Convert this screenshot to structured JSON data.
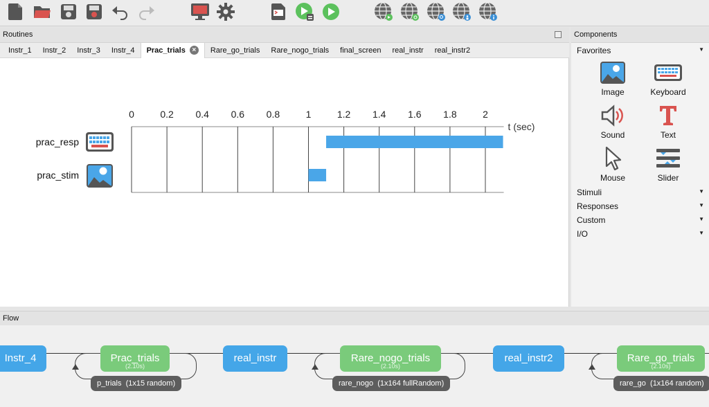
{
  "toolbar": {
    "buttons": [
      {
        "icon": "new-file-icon"
      },
      {
        "icon": "open-folder-icon"
      },
      {
        "icon": "save-icon"
      },
      {
        "icon": "save-as-icon"
      },
      {
        "icon": "undo-icon"
      },
      {
        "icon": "redo-icon"
      },
      {
        "icon": "monitor-icon"
      },
      {
        "icon": "gear-icon"
      },
      {
        "icon": "compile-script-icon"
      },
      {
        "icon": "run-pilot-icon"
      },
      {
        "icon": "run-icon"
      },
      {
        "icon": "globe-sync-icon"
      },
      {
        "icon": "globe-run-icon"
      },
      {
        "icon": "globe-search-icon"
      },
      {
        "icon": "globe-user-icon"
      },
      {
        "icon": "globe-info-icon"
      }
    ]
  },
  "routines": {
    "title": "Routines",
    "tabs": [
      "Instr_1",
      "Instr_2",
      "Instr_3",
      "Instr_4",
      "Prac_trials",
      "Rare_go_trials",
      "Rare_nogo_trials",
      "final_screen",
      "real_instr",
      "real_instr2"
    ],
    "active_tab": "Prac_trials",
    "timeline": {
      "axis_label": "t (sec)",
      "ticks": [
        "0",
        "0.2",
        "0.4",
        "0.6",
        "0.8",
        "1",
        "1.2",
        "1.4",
        "1.6",
        "1.8",
        "2"
      ],
      "tmax": 2.1,
      "components": [
        {
          "name": "prac_resp",
          "icon": "keyboard-icon",
          "start": 1.1,
          "end": 2.1
        },
        {
          "name": "prac_stim",
          "icon": "image-icon",
          "start": 1.0,
          "end": 1.1
        }
      ]
    }
  },
  "components": {
    "title": "Components",
    "favorites_label": "Favorites",
    "favorites": [
      {
        "label": "Image",
        "icon": "image-icon"
      },
      {
        "label": "Keyboard",
        "icon": "keyboard-icon"
      },
      {
        "label": "Sound",
        "icon": "speaker-icon"
      },
      {
        "label": "Text",
        "icon": "text-icon"
      },
      {
        "label": "Mouse",
        "icon": "mouse-pointer-icon"
      },
      {
        "label": "Slider",
        "icon": "slider-icon"
      }
    ],
    "categories": [
      "Stimuli",
      "Responses",
      "Custom",
      "I/O"
    ]
  },
  "flow": {
    "title": "Flow",
    "routines": [
      {
        "label": "Instr_4",
        "color": "#44a6e8"
      },
      {
        "label": "Prac_trials",
        "duration": "(2.10s)",
        "color": "#7acb7b"
      },
      {
        "label": "real_instr",
        "color": "#44a6e8"
      },
      {
        "label": "Rare_nogo_trials",
        "duration": "(2.10s)",
        "color": "#7acb7b"
      },
      {
        "label": "real_instr2",
        "color": "#44a6e8"
      },
      {
        "label": "Rare_go_trials",
        "duration": "(2.10s)",
        "color": "#7acb7b"
      }
    ],
    "loops": [
      {
        "label": "p_trials  (1x15 random)"
      },
      {
        "label": "rare_nogo  (1x164 fullRandom)"
      },
      {
        "label": "rare_go  (1x164 random)"
      }
    ]
  }
}
